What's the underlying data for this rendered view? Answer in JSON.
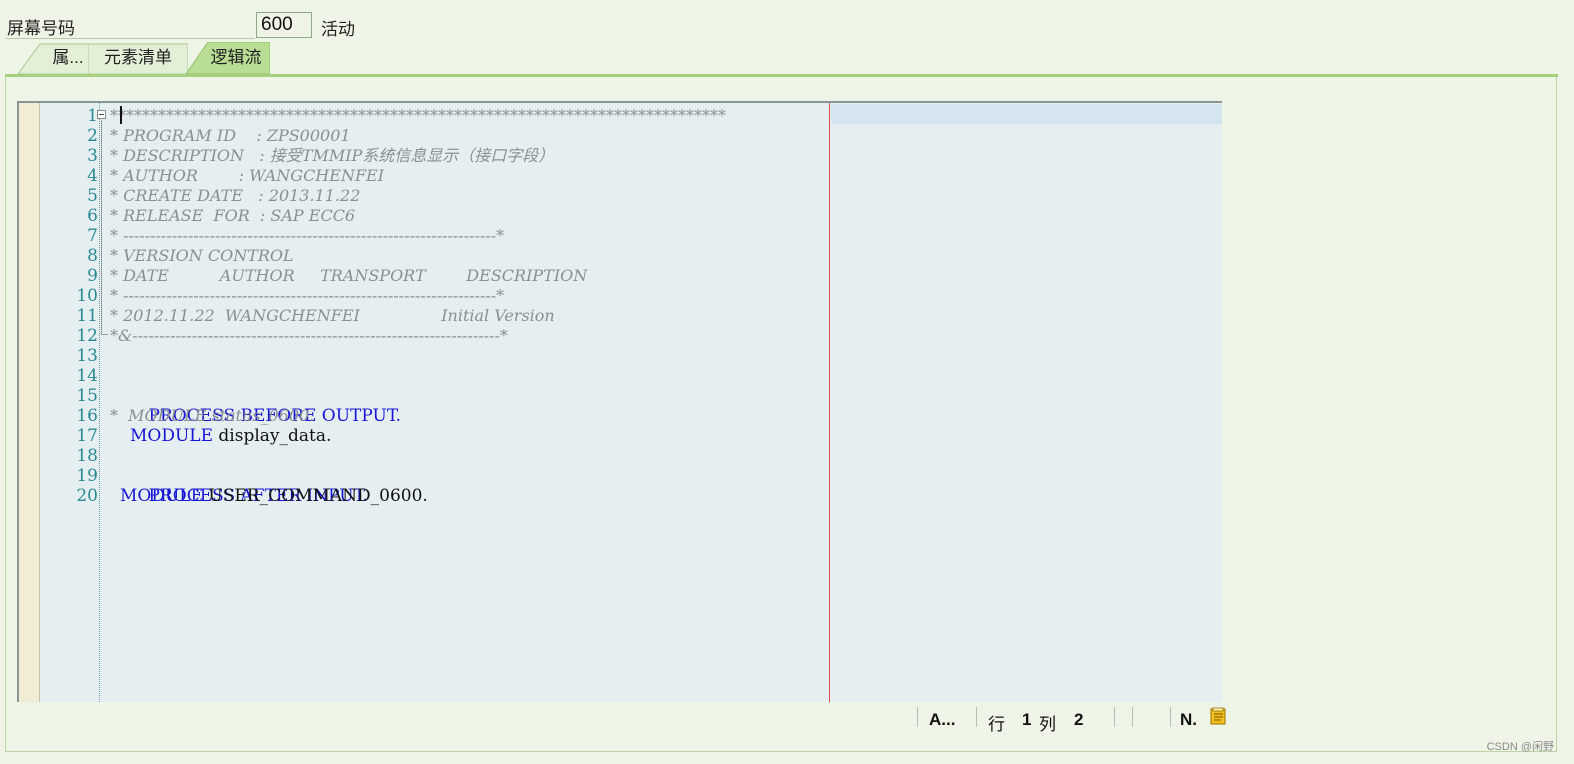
{
  "header": {
    "screen_label": "屏幕号码",
    "screen_number": "600",
    "status": "活动"
  },
  "tabs": [
    {
      "label": "属..."
    },
    {
      "label": "元素清单"
    },
    {
      "label": "逻辑流"
    }
  ],
  "editor": {
    "line_numbers": [
      "1",
      "2",
      "3",
      "4",
      "5",
      "6",
      "7",
      "8",
      "9",
      "10",
      "11",
      "12",
      "13",
      "14",
      "15",
      "16",
      "17",
      "18",
      "19",
      "20"
    ],
    "lines": {
      "l1": "*****************************************************************************",
      "l2": "* PROGRAM ID    : ZPS00001",
      "l3": "* DESCRIPTION   : 接受TMMIP系统信息显示（接口字段）",
      "l4": "* AUTHOR        : WANGCHENFEI",
      "l5": "* CREATE DATE   : 2013.11.22",
      "l6": "* RELEASE  FOR  : SAP ECC6",
      "l7": "* ---------------------------------------------------------------------*",
      "l8": "* VERSION CONTROL",
      "l9": "* DATE          AUTHOR     TRANSPORT        DESCRIPTION",
      "l10": "* ---------------------------------------------------------------------*",
      "l11": "* 2012.11.22  WANGCHENFEI                Initial Version",
      "l12": "*&--------------------------------------------------------------------*",
      "l15": {
        "kw": "PROCESS BEFORE OUTPUT."
      },
      "l16": "*  MODULE status_0600.",
      "l17": {
        "kw": "MODULE",
        "rest": " display_data."
      },
      "l19": {
        "kw": "PROCESS AFTER INPUT."
      },
      "l20": {
        "kw": "MODULE",
        "rest": " USER_COMMAND_0600."
      }
    }
  },
  "statusbar": {
    "mode": "A...",
    "row_label": "行",
    "row_value": "1",
    "col_label": "列",
    "col_value": "2",
    "n": "N.",
    "note_icon": "note-icon"
  },
  "watermark": "CSDN @闲野",
  "colors": {
    "background": "#eef5e6",
    "tab_active": "#b9dd95",
    "keyword": "#1515d6",
    "comment": "#8c8f92",
    "line_number": "#2a8a92",
    "margin_line": "#e44a4a"
  }
}
